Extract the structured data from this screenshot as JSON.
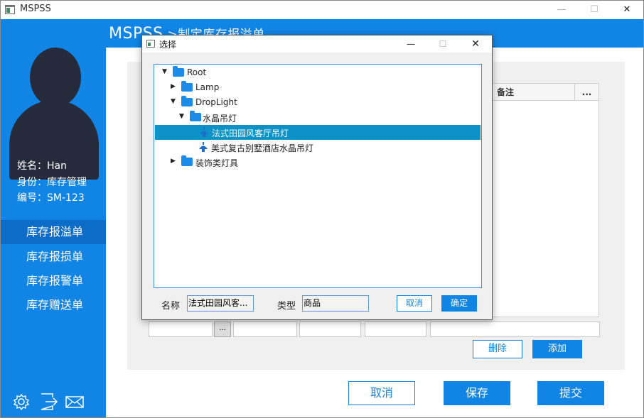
{
  "window": {
    "title": "MSPSS",
    "min": "—",
    "max": "☐",
    "close": "✕"
  },
  "header": {
    "app": "MSPSS",
    "crumb": " >制定库存报溢单"
  },
  "user": {
    "name": "姓名：Han",
    "role": "身份：库存管理",
    "id": "编号：SM-123"
  },
  "nav": [
    {
      "label": "库存报溢单",
      "active": true
    },
    {
      "label": "库存报损单"
    },
    {
      "label": "库存报警单"
    },
    {
      "label": "库存赠送单"
    }
  ],
  "grid": {
    "columns": [
      "备注",
      "..."
    ]
  },
  "editor": {
    "dots": "..."
  },
  "actions": {
    "delete": "删除",
    "add": "添加"
  },
  "footer": {
    "cancel": "取消",
    "save": "保存",
    "submit": "提交"
  },
  "dialog": {
    "title": "选择",
    "min": "—",
    "max": "☐",
    "close": "✕",
    "tree": [
      {
        "label": "Root",
        "expanded": true
      },
      {
        "label": "Lamp",
        "expanded": false
      },
      {
        "label": "DropLight",
        "expanded": true
      },
      {
        "label": "水晶吊灯",
        "expanded": true
      },
      {
        "label": "法式田园风客厅吊灯",
        "selected": true
      },
      {
        "label": "美式复古别墅酒店水晶吊灯"
      },
      {
        "label": "装饰类灯具",
        "expanded": false
      }
    ],
    "name_label": "名称",
    "name_value": "法式田园风客...",
    "type_label": "类型",
    "type_value": "商品",
    "cancel": "取消",
    "confirm": "确定"
  },
  "colors": {
    "primary": "#1185e6",
    "selected": "#0d92c7",
    "avatar": "#252b3b"
  }
}
